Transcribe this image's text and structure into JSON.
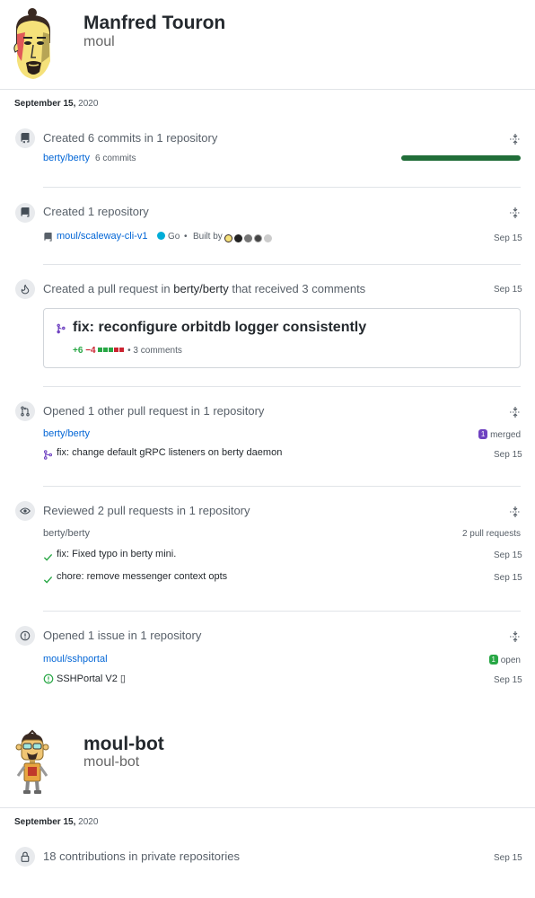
{
  "users": [
    {
      "name": "Manfred Touron",
      "login": "moul",
      "date_day": "September 15,",
      "date_year": "2020"
    },
    {
      "name": "moul-bot",
      "login": "moul-bot",
      "date_day": "September 15,",
      "date_year": "2020"
    }
  ],
  "events": {
    "commits": {
      "title": "Created 6 commits in 1 repository",
      "repo": "berty/berty",
      "count": "6 commits",
      "bar_fraction": 1.0,
      "bar_color": "#216e39"
    },
    "repo_created": {
      "title": "Created 1 repository",
      "repo": "moul/scaleway-cli-v1",
      "language": "Go",
      "language_color": "#00ADD8",
      "separator": "•",
      "built_by": "Built by",
      "date": "Sep 15"
    },
    "pull_request": {
      "title_prefix": "Created a pull request in",
      "title_repo": "berty/berty",
      "title_suffix": "that received 3 comments",
      "date": "Sep 15",
      "pr_title": "fix: reconfigure orbitdb logger consistently",
      "additions": "+6",
      "deletions": "−4",
      "comments": "• 3 comments"
    },
    "opened_pr": {
      "title": "Opened 1 other pull request in 1 repository",
      "repo": "berty/berty",
      "badge_count": "1",
      "badge_label": "merged",
      "badge_color": "#6f42c1",
      "item": "fix: change default gRPC listeners on berty daemon",
      "date": "Sep 15"
    },
    "reviewed": {
      "title": "Reviewed 2 pull requests in 1 repository",
      "repo": "berty/berty",
      "count": "2 pull requests",
      "items": [
        {
          "label": "fix: Fixed typo in berty mini.",
          "date": "Sep 15"
        },
        {
          "label": "chore: remove messenger context opts",
          "date": "Sep 15"
        }
      ]
    },
    "issue": {
      "title": "Opened 1 issue in 1 repository",
      "repo": "moul/sshportal",
      "badge_count": "1",
      "badge_label": "open",
      "badge_color": "#28a745",
      "item": "SSHPortal V2 ▯",
      "date": "Sep 15"
    },
    "private": {
      "title": "18 contributions in private repositories",
      "date": "Sep 15"
    }
  },
  "colors": {
    "link": "#0366d6",
    "addition": "#28a745",
    "deletion": "#cb2431",
    "merged": "#6f42c1"
  }
}
